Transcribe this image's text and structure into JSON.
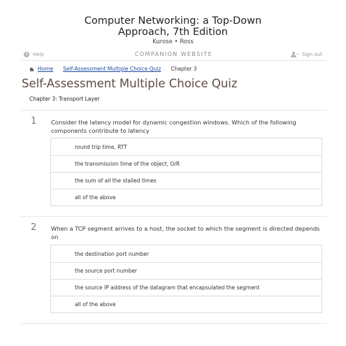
{
  "book": {
    "title_line1": "Computer Networking: a Top-Down",
    "title_line2": "Approach, 7th Edition",
    "authors": "Kurose • Ross"
  },
  "util_bar": {
    "help_label": "Help",
    "companion_label": "COMPANION WEBSITE",
    "signout_label": "Sign out",
    "help_icon": "info-icon",
    "signout_icon": "user-icon"
  },
  "breadcrumb": {
    "home": "Home",
    "quiz": "Self-Assessment Multiple Choice Quiz",
    "current": "Chapter 3"
  },
  "page": {
    "title": "Self-Assessment Multiple Choice Quiz",
    "chapter": "Chapter 3: Transport Layer"
  },
  "questions": [
    {
      "number": "1",
      "text": "Consider the latency model for dynamic congestion windows. Which of the following components contribute to latency",
      "answers": [
        "round trip time, RTT",
        "the transmission time of the object, O/R",
        "the sum of all the stalled times",
        "all of the above"
      ]
    },
    {
      "number": "2",
      "text": "When a TCP segment arrives to a host, the socket to which the segment is directed depends on",
      "answers": [
        "the destination port number",
        "the source port number",
        "the source IP address of the datagram that encapsulated the segment",
        "all of the above"
      ]
    }
  ],
  "colors": {
    "title": "#5e4a42",
    "link": "#1a4a9e",
    "border": "#dcdcdc"
  }
}
